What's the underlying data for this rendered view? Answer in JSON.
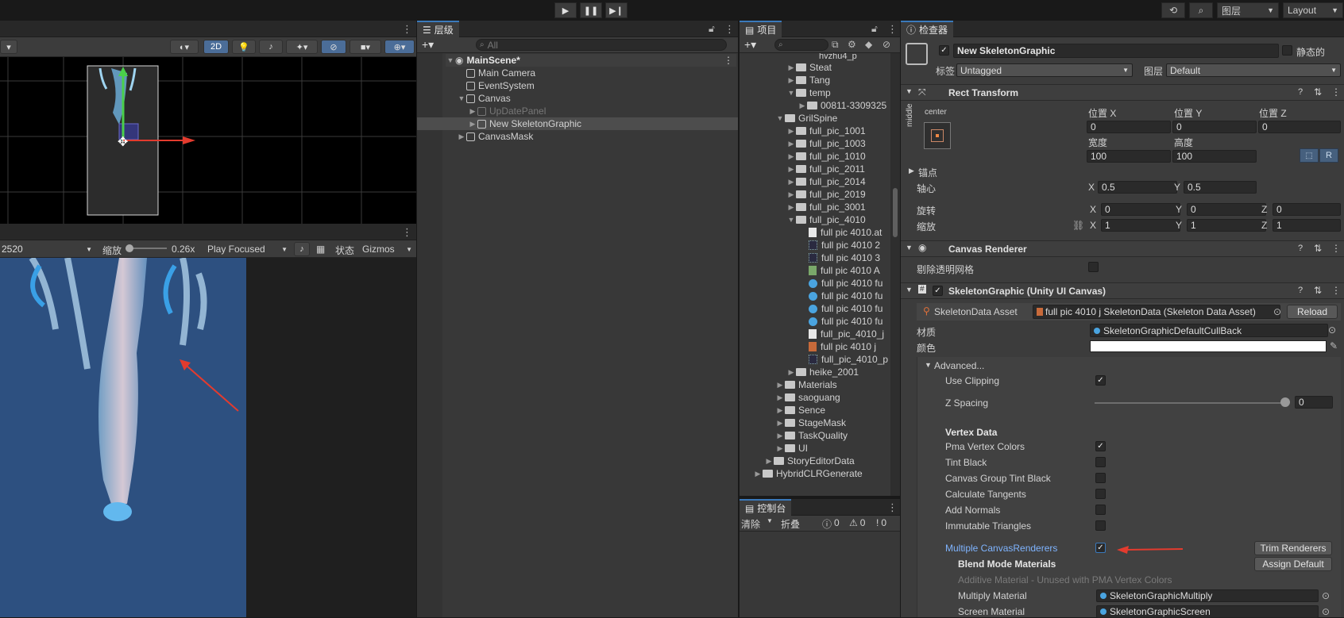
{
  "topbar": {
    "history_icon": "history-icon",
    "search_icon": "search-icon",
    "layers_label": "图层",
    "layout_label": "Layout"
  },
  "scene": {
    "mode_2d": "2D"
  },
  "game": {
    "resolution": "2520",
    "zoom_label": "缩放",
    "zoom_value": "0.26x",
    "play_mode": "Play Focused",
    "stats_label": "状态",
    "gizmos_label": "Gizmos"
  },
  "hierarchy": {
    "title": "层级",
    "search_placeholder": "All",
    "scene_name": "MainScene*",
    "items": [
      {
        "label": "Main Camera"
      },
      {
        "label": "EventSystem"
      },
      {
        "label": "Canvas"
      },
      {
        "label": "UpDatePanel"
      },
      {
        "label": "New SkeletonGraphic"
      },
      {
        "label": "CanvasMask"
      }
    ]
  },
  "project": {
    "title": "项目",
    "items": [
      {
        "label": "hvzhu4_p"
      },
      {
        "label": "Steat"
      },
      {
        "label": "Tang"
      },
      {
        "label": "temp"
      },
      {
        "label": "00811-3309325"
      },
      {
        "label": "GrilSpine"
      },
      {
        "label": "full_pic_1001"
      },
      {
        "label": "full_pic_1003"
      },
      {
        "label": "full_pic_1010"
      },
      {
        "label": "full_pic_2011"
      },
      {
        "label": "full_pic_2014"
      },
      {
        "label": "full_pic_2019"
      },
      {
        "label": "full_pic_3001"
      },
      {
        "label": "full_pic_4010"
      },
      {
        "label": "full pic 4010.at"
      },
      {
        "label": "full pic 4010 2"
      },
      {
        "label": "full pic 4010 3"
      },
      {
        "label": "full pic 4010 A"
      },
      {
        "label": "full pic 4010 fu"
      },
      {
        "label": "full pic 4010 fu"
      },
      {
        "label": "full pic 4010 fu"
      },
      {
        "label": "full pic 4010 fu"
      },
      {
        "label": "full_pic_4010_j"
      },
      {
        "label": "full pic 4010 j"
      },
      {
        "label": "full_pic_4010_p"
      },
      {
        "label": "heike_2001"
      },
      {
        "label": "Materials"
      },
      {
        "label": "saoguang"
      },
      {
        "label": "Sence"
      },
      {
        "label": "StageMask"
      },
      {
        "label": "TaskQuality"
      },
      {
        "label": "UI"
      },
      {
        "label": "StoryEditorData"
      },
      {
        "label": "HybridCLRGenerate"
      }
    ]
  },
  "console": {
    "title": "控制台",
    "clear": "清除",
    "collapse": "折叠",
    "info_count": "0",
    "warn_count": "0",
    "error_count": "0"
  },
  "inspector": {
    "title": "检查器",
    "object_name": "New SkeletonGraphic",
    "static_label": "静态的",
    "tag_label": "标签",
    "tag_value": "Untagged",
    "layer_label": "图层",
    "layer_value": "Default",
    "rect_transform": {
      "title": "Rect Transform",
      "anchor_h": "center",
      "anchor_v": "middle",
      "pos_x_label": "位置 X",
      "pos_y_label": "位置 Y",
      "pos_z_label": "位置 Z",
      "pos_x": "0",
      "pos_y": "0",
      "pos_z": "0",
      "width_label": "宽度",
      "height_label": "高度",
      "width": "100",
      "height": "100",
      "r_button": "R",
      "anchors_label": "锚点",
      "pivot_label": "轴心",
      "pivot_x": "0.5",
      "pivot_y": "0.5",
      "rotation_label": "旋转",
      "rot_x": "0",
      "rot_y": "0",
      "rot_z": "0",
      "scale_label": "缩放",
      "scale_x": "1",
      "scale_y": "1",
      "scale_z": "1",
      "x": "X",
      "y": "Y",
      "z": "Z"
    },
    "canvas_renderer": {
      "title": "Canvas Renderer",
      "cull_label": "剔除透明网格"
    },
    "skeleton_graphic": {
      "title": "SkeletonGraphic (Unity UI Canvas)",
      "data_asset_label": "SkeletonData Asset",
      "data_asset_value": "full pic 4010 j SkeletonData (Skeleton Data Asset)",
      "reload": "Reload",
      "material_label": "材质",
      "material_value": "SkeletonGraphicDefaultCullBack",
      "color_label": "颜色",
      "advanced": "Advanced...",
      "use_clipping": "Use Clipping",
      "z_spacing": "Z Spacing",
      "z_spacing_value": "0",
      "vertex_data": "Vertex Data",
      "pma_vertex_colors": "Pma Vertex Colors",
      "tint_black": "Tint Black",
      "canvas_group_tint_black": "Canvas Group Tint Black",
      "calculate_tangents": "Calculate Tangents",
      "add_normals": "Add Normals",
      "immutable_triangles": "Immutable Triangles",
      "multiple_canvas_renderers": "Multiple CanvasRenderers",
      "trim_renderers": "Trim Renderers",
      "blend_mode_materials": "Blend Mode Materials",
      "assign_default": "Assign Default",
      "additive_material": "Additive Material - Unused with PMA Vertex Colors",
      "multiply_material_label": "Multiply Material",
      "multiply_material_value": "SkeletonGraphicMultiply",
      "screen_material_label": "Screen Material",
      "screen_material_value": "SkeletonGraphicScreen"
    }
  },
  "colors": {
    "accent": "#3a79bb",
    "link": "#7fb4ff",
    "arrow": "#e33b2e",
    "game_bg": "#2d5080"
  }
}
